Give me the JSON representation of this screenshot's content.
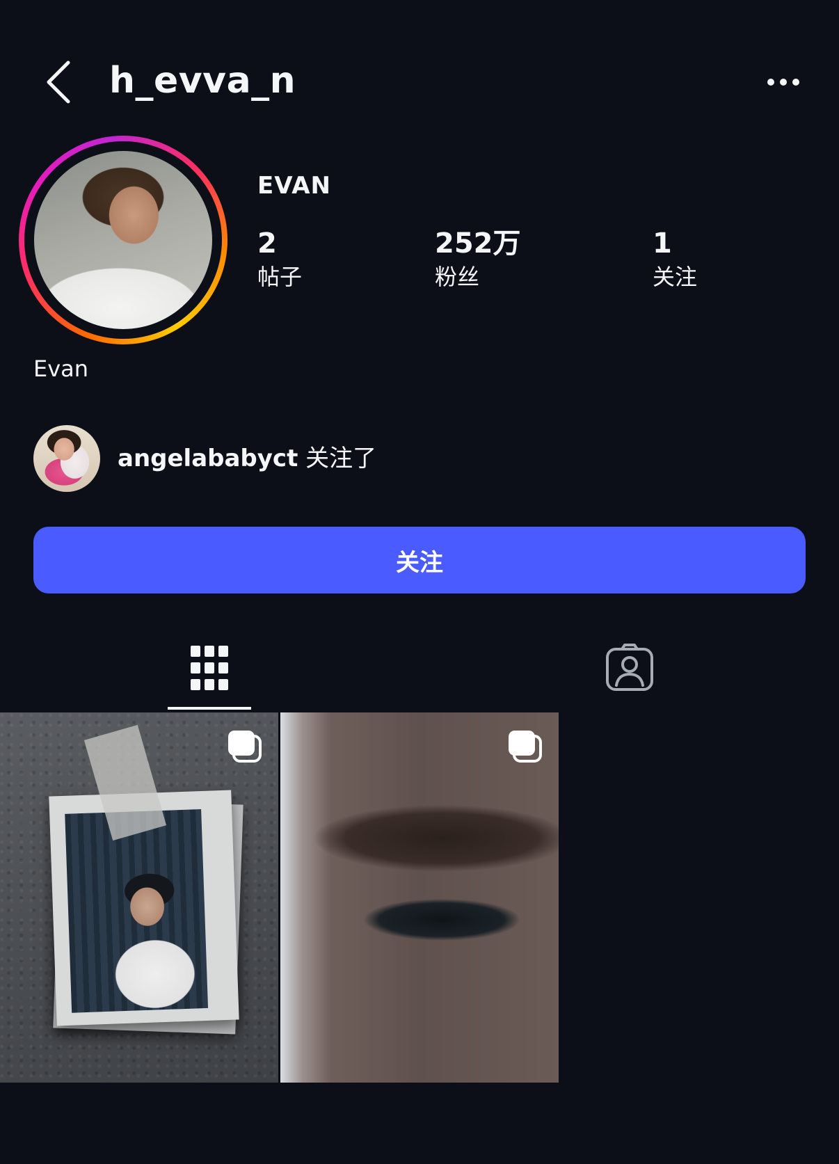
{
  "header": {
    "username": "h_evva_n",
    "back_icon": "chevron-left-icon",
    "more_icon": "more-horizontal-icon"
  },
  "profile": {
    "display_name": "EVAN",
    "bio_name": "Evan",
    "story_ring_colors": [
      "#ffcc00",
      "#ff6a00",
      "#ff2e63",
      "#c026d3"
    ],
    "stats": [
      {
        "value": "2",
        "label": "帖子"
      },
      {
        "value": "252万",
        "label": "粉丝"
      },
      {
        "value": "1",
        "label": "关注"
      }
    ]
  },
  "followed_by": {
    "username": "angelababyct",
    "suffix": " 关注了"
  },
  "follow_button": {
    "label": "关注",
    "color": "#4a5cff"
  },
  "tabs": [
    {
      "name": "grid",
      "icon": "grid-icon",
      "active": true
    },
    {
      "name": "tagged",
      "icon": "tagged-person-icon",
      "active": false
    }
  ],
  "posts": [
    {
      "type": "carousel",
      "icon": "multiple-photos-icon"
    },
    {
      "type": "carousel",
      "icon": "multiple-photos-icon"
    }
  ],
  "colors": {
    "background": "#0c0f17",
    "text": "#f5f6f8",
    "accent": "#4a5cff"
  }
}
